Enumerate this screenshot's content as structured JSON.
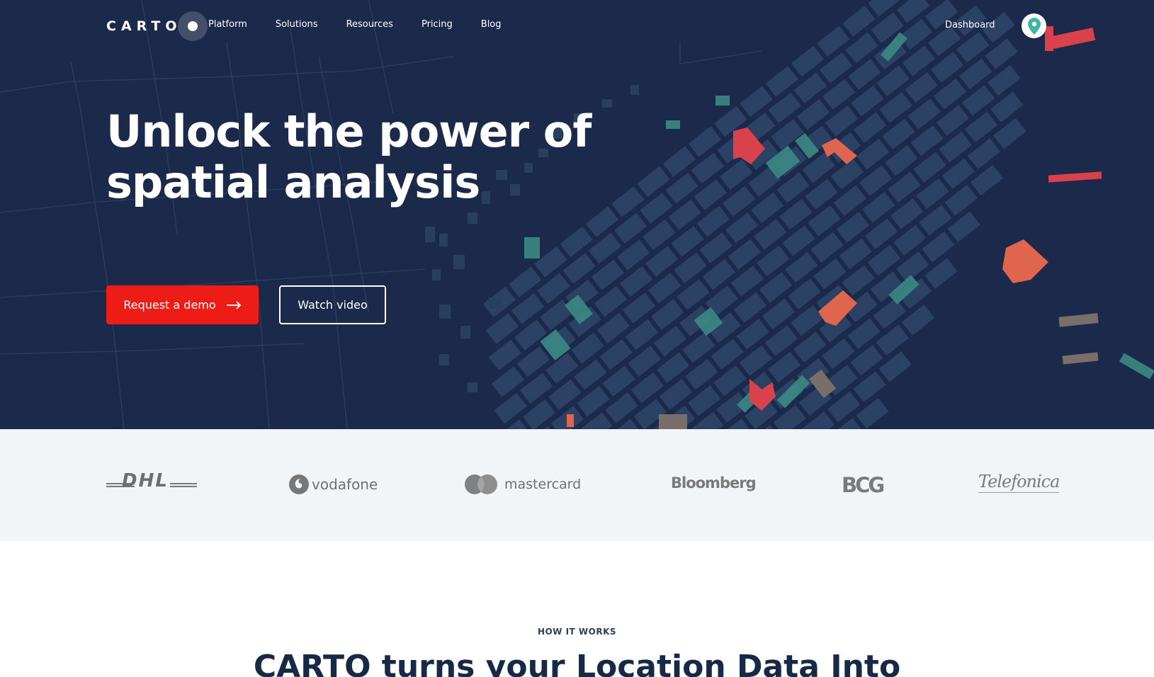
{
  "brand": {
    "name": "CARTO"
  },
  "nav": {
    "links": [
      "Platform",
      "Solutions",
      "Resources",
      "Pricing",
      "Blog"
    ],
    "dashboard_label": "Dashboard"
  },
  "hero": {
    "title_line1": "Unlock the power of",
    "title_line2": "spatial analysis",
    "primary_button": "Request a demo",
    "secondary_button": "Watch video"
  },
  "clients": {
    "logos": [
      "DHL",
      "vodafone",
      "mastercard",
      "Bloomberg",
      "BCG",
      "Telefonica"
    ]
  },
  "how_it_works": {
    "label": "HOW IT WORKS",
    "title": "CARTO turns your Location Data Into"
  },
  "colors": {
    "hero_bg": "#1b2a4a",
    "accent_red": "#ed1c16",
    "map_teal": "#3fa49a",
    "map_coral": "#e35b4f",
    "logos_bg": "#f2f5f8"
  }
}
